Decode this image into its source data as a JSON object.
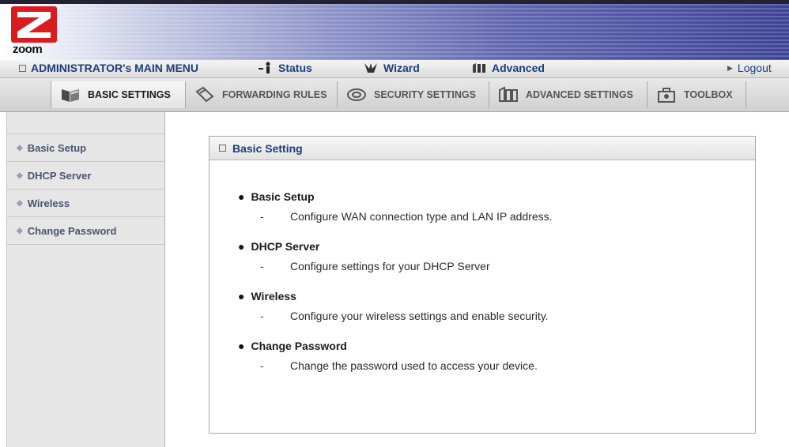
{
  "brand": {
    "logo_text": "zoom"
  },
  "main_menu": {
    "title": "ADMINISTRATOR's MAIN MENU",
    "status": "Status",
    "wizard": "Wizard",
    "advanced": "Advanced",
    "logout": "Logout"
  },
  "tabs": [
    {
      "label": "BASIC SETTINGS",
      "icon": "folder-book-icon",
      "active": true
    },
    {
      "label": "FORWARDING RULES",
      "icon": "forwarding-icon",
      "active": false
    },
    {
      "label": "SECURITY SETTINGS",
      "icon": "lock-disc-icon",
      "active": false
    },
    {
      "label": "ADVANCED SETTINGS",
      "icon": "cabinet-icon",
      "active": false
    },
    {
      "label": "TOOLBOX",
      "icon": "toolbox-icon",
      "active": false
    }
  ],
  "sidebar": {
    "items": [
      {
        "label": "Basic Setup"
      },
      {
        "label": "DHCP Server"
      },
      {
        "label": "Wireless"
      },
      {
        "label": "Change Password"
      }
    ]
  },
  "panel": {
    "title": "Basic Setting",
    "entries": [
      {
        "title": "Basic Setup",
        "dash": "-",
        "desc": "Configure WAN connection type and LAN IP address."
      },
      {
        "title": "DHCP Server",
        "dash": "-",
        "desc": "Configure settings for your DHCP Server"
      },
      {
        "title": "Wireless",
        "dash": "-",
        "desc": "Configure your wireless settings and enable security."
      },
      {
        "title": "Change Password",
        "dash": "-",
        "desc": "Change the password used to access your device."
      }
    ]
  },
  "colors": {
    "accent": "#1a3d7c",
    "logo_red": "#d91c20",
    "banner_blue": "#3d4396"
  }
}
